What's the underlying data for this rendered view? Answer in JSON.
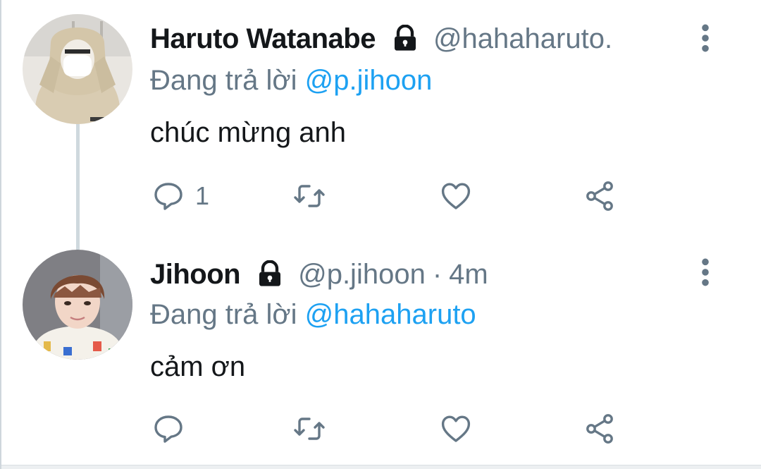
{
  "colors": {
    "accent": "#1da1f2",
    "secondary_text": "#657786",
    "primary_text": "#14171a",
    "thread_line": "#cfd9de"
  },
  "tweets": [
    {
      "name": "Haruto Watanabe",
      "handle": "@hahaharuto.",
      "protected_icon": "lock-icon",
      "time": "",
      "replying_label": "Đang trả lời",
      "replying_to": "@p.jihoon",
      "text": "chúc mừng anh",
      "reply_count": "1",
      "icons": [
        "reply-icon",
        "retweet-icon",
        "like-icon",
        "share-icon",
        "more-options-icon"
      ]
    },
    {
      "name": "Jihoon",
      "handle": "@p.jihoon",
      "separator": "·",
      "time": "4m",
      "protected_icon": "lock-icon",
      "replying_label": "Đang trả lời",
      "replying_to": "@hahaharuto",
      "text": "cảm ơn",
      "reply_count": "",
      "icons": [
        "reply-icon",
        "retweet-icon",
        "like-icon",
        "share-icon",
        "more-options-icon"
      ]
    }
  ]
}
